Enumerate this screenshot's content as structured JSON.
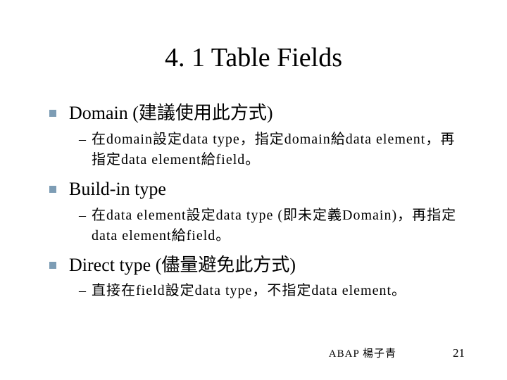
{
  "title": "4. 1 Table Fields",
  "items": [
    {
      "title": "Domain (建議使用此方式)",
      "sub": "在domain設定data type，指定domain給data element，再指定data element給field。"
    },
    {
      "title": "Build-in type",
      "sub": "在data element設定data type (即未定義Domain)，再指定data element給field。"
    },
    {
      "title": "Direct type (儘量避免此方式)",
      "sub": "直接在field設定data type，不指定data element。"
    }
  ],
  "footer": {
    "text": "ABAP 楊子青",
    "page": "21"
  }
}
